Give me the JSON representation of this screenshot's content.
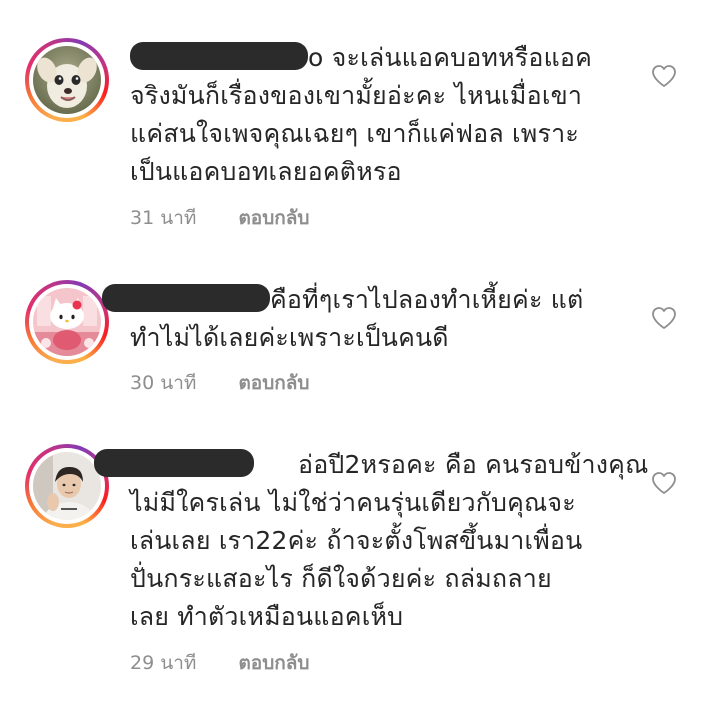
{
  "comments": [
    {
      "avatar": "dog-photo-avatar",
      "text_tail_line1": "o จะเล่นแอคบอทหรือแอค",
      "lines": [
        "จริงมันก็เรื่องของเขามั้ยอ่ะคะ ไหนเมื่อเขา",
        "แค่สนใจเพจคุณเฉยๆ เขาก็แค่ฟอล เพราะ",
        "เป็นแอคบอทเลยอคติหรอ"
      ],
      "time": "31 นาที",
      "reply": "ตอบกลับ"
    },
    {
      "avatar": "hello-kitty-photo-avatar",
      "text_tail_line1": "คือที่ๆเราไปลองทำเหี้ยค่ะ แต่",
      "lines": [
        "ทำไม่ได้เลยค่ะเพราะเป็นคนดี"
      ],
      "time": "30 นาที",
      "reply": "ตอบกลับ"
    },
    {
      "avatar": "person-photo-avatar",
      "text_tail_line1": "อ่อปี2หรอคะ คือ คนรอบข้างคุณ",
      "lines": [
        "ไม่มีใครเล่น ไม่ใช่ว่าคนรุ่นเดียวกับคุณจะ",
        "เล่นเลย เรา22ค่ะ ถ้าจะตั้งโพสขึ้นมาเพื่อน",
        "ปั่นกระแสอะไร ก็ดีใจด้วยค่ะ ถล่มถลาย",
        "เลย ทำตัวเหมือนแอคเห็บ"
      ],
      "time": "29 นาที",
      "reply": "ตอบกลับ"
    }
  ],
  "icons": {
    "like": "heart-outline-icon"
  },
  "colors": {
    "text": "#262626",
    "meta": "#8e8e8e",
    "redaction": "#2b2b2b"
  }
}
